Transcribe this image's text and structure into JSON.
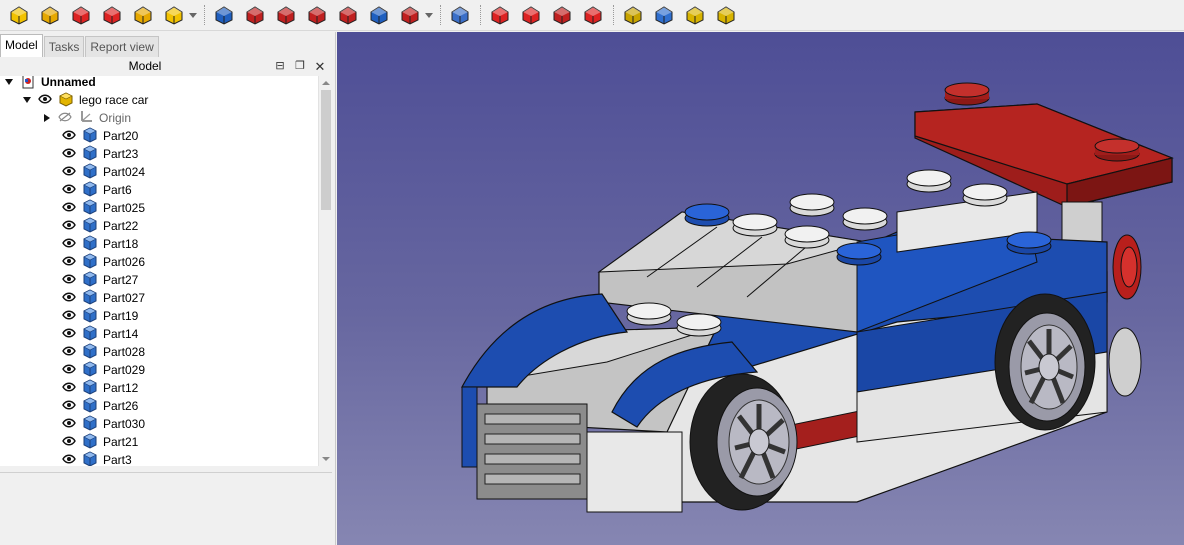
{
  "tabs": [
    "Model",
    "Tasks",
    "Report view"
  ],
  "panel": {
    "title": "Model"
  },
  "tree": {
    "root": "Unnamed",
    "assembly": "lego race car",
    "origin": "Origin",
    "parts": [
      "Part20",
      "Part23",
      "Part024",
      "Part6",
      "Part025",
      "Part22",
      "Part18",
      "Part026",
      "Part27",
      "Part027",
      "Part19",
      "Part14",
      "Part028",
      "Part029",
      "Part12",
      "Part26",
      "Part030",
      "Part21",
      "Part3"
    ]
  },
  "toolbar": {
    "icons": [
      "pad-icon",
      "revolution-icon",
      "additive-loft-icon",
      "additive-pipe-icon",
      "additive-helix-icon",
      "additive-box-icon",
      "pocket-icon",
      "hole-icon",
      "groove-icon",
      "subtractive-loft-icon",
      "subtractive-pipe-icon",
      "subtractive-helix-icon",
      "subtractive-box-icon",
      "boolean-icon",
      "fillet-icon",
      "chamfer-icon",
      "draft-icon",
      "thickness-icon",
      "mirrored-icon",
      "linear-pattern-icon",
      "polar-pattern-icon",
      "multitransform-icon"
    ]
  },
  "colors": {
    "viewport_top": "#4e4e96",
    "viewport_bottom": "#8686b2",
    "car_blue": "#1e4fb4",
    "car_grey": "#c8c8c8",
    "car_red": "#a8201e"
  }
}
